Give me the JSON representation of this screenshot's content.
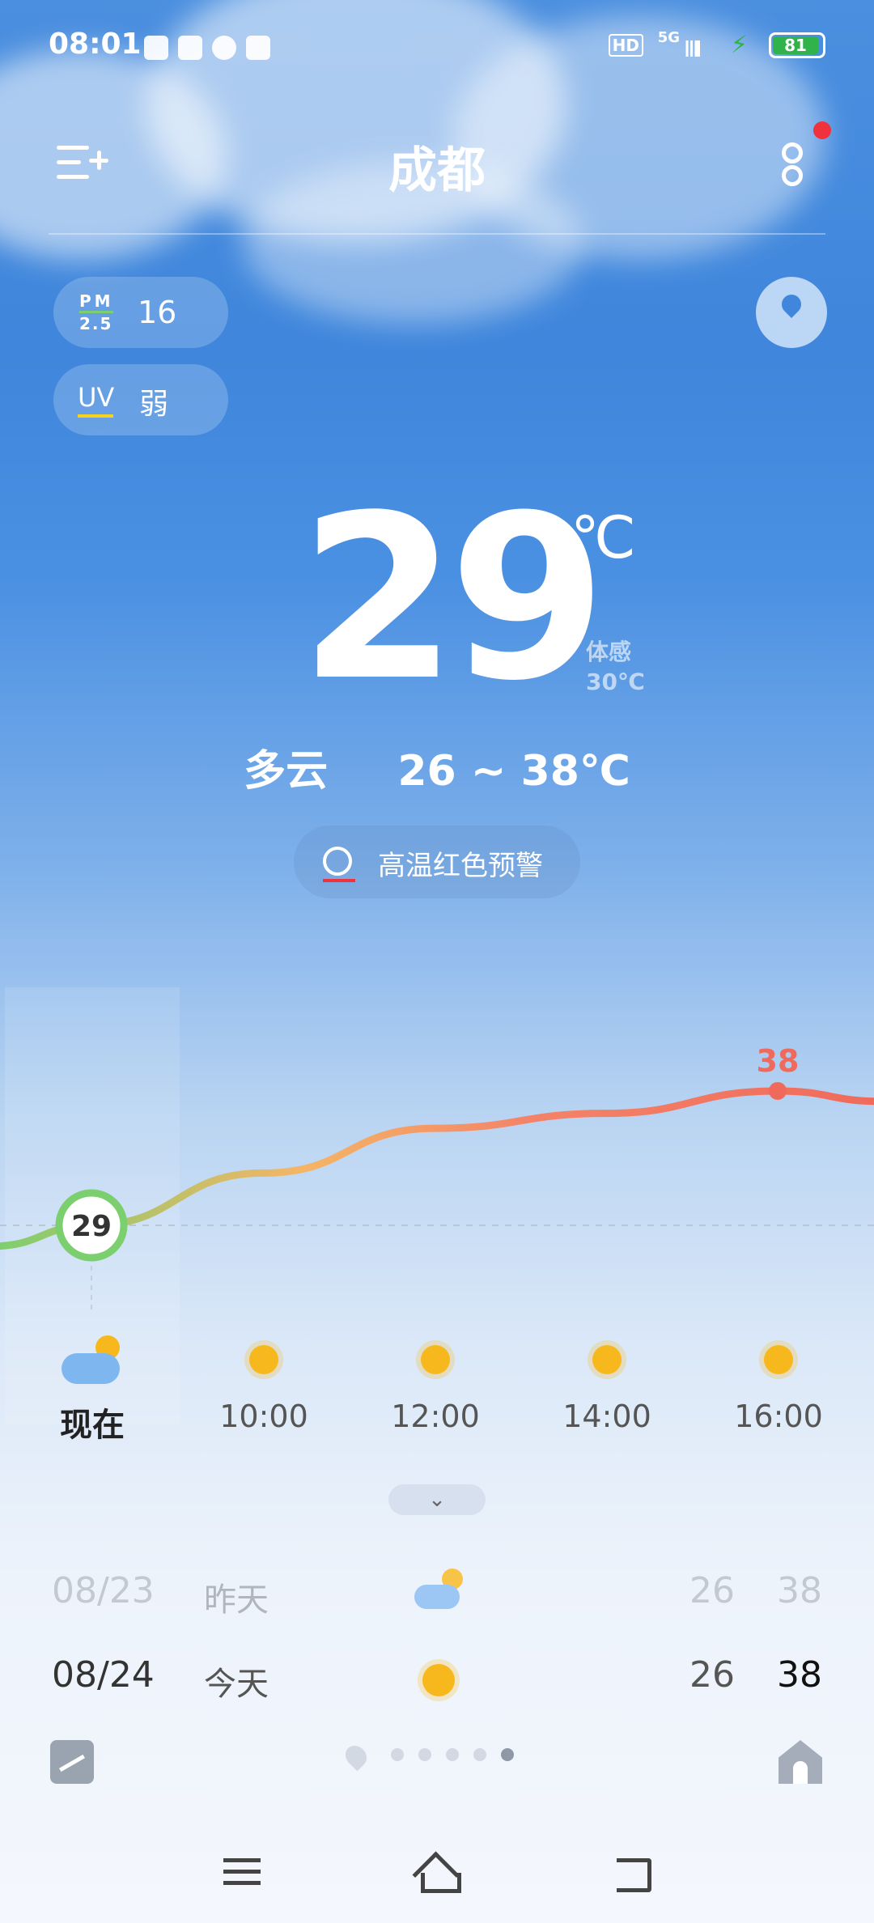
{
  "status_bar": {
    "time": "08:01",
    "battery": "81",
    "network": "5G",
    "hd": "HD"
  },
  "header": {
    "city": "成都"
  },
  "air": {
    "pm_label_top": "PM",
    "pm_label_bottom": "2.5",
    "pm_value": "16",
    "uv_label": "UV",
    "uv_value": "弱"
  },
  "current": {
    "temp": "29",
    "unit": "℃",
    "feels_label": "体感",
    "feels_value": "30℃",
    "condition": "多云",
    "range": "26 ~ 38℃",
    "alert": "高温红色预警"
  },
  "chart_data": {
    "type": "line",
    "x": [
      "现在",
      "10:00",
      "12:00",
      "14:00",
      "16:00"
    ],
    "series": [
      {
        "values": [
          29,
          32.5,
          35.5,
          36.5,
          38
        ]
      }
    ],
    "labels": {
      "current": "29",
      "max": "38"
    }
  },
  "hourly": [
    {
      "time": "现在",
      "icon": "partly-cloudy-icon"
    },
    {
      "time": "10:00",
      "icon": "sun-icon"
    },
    {
      "time": "12:00",
      "icon": "sun-icon"
    },
    {
      "time": "14:00",
      "icon": "sun-icon"
    },
    {
      "time": "16:00",
      "icon": "sun-icon"
    }
  ],
  "daily": [
    {
      "date": "08/23",
      "day": "昨天",
      "icon": "partly-cloudy-icon",
      "low": "26",
      "high": "38"
    },
    {
      "date": "08/24",
      "day": "今天",
      "icon": "sun-icon",
      "low": "26",
      "high": "38"
    }
  ],
  "colors": {
    "hot": "#f06a5c",
    "cool": "#7ccf6e",
    "sun": "#f7b81d",
    "sky": "#3f86dc"
  }
}
